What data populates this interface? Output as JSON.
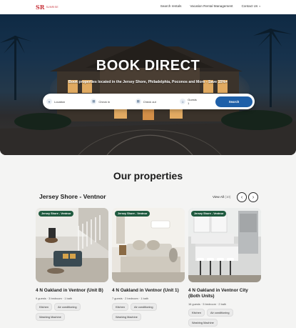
{
  "nav": {
    "logo_mark": "SR",
    "logo_text": "SUNRISE",
    "items": [
      {
        "label": "Search rentals",
        "has_caret": false
      },
      {
        "label": "Vacation Rental Management",
        "has_caret": false
      },
      {
        "label": "Contact Us",
        "has_caret": true
      }
    ]
  },
  "hero": {
    "title": "BOOK DIRECT",
    "subtitle": "Book properties located in the Jersey Shore, Philadelphia, Poconos and More - Save 15%+"
  },
  "search": {
    "location_label": "Location",
    "checkin_label": "Check in",
    "checkout_label": "Check out",
    "guests_label": "Guests",
    "guests_value": "1",
    "button_label": "Search"
  },
  "section": {
    "title": "Our properties",
    "group_title": "Jersey Shore - Ventnor",
    "view_all_label": "View All",
    "view_all_count": "(10)"
  },
  "cards": [
    {
      "badge": "Jersey Shore - Ventnor",
      "title": "4 N Oakland in Ventnor (Unit B)",
      "meta": "9 guests  ·  3 bedroom  ·  1 bath",
      "tags": [
        "Kitchen",
        "Air conditioning",
        "Washing Machine"
      ]
    },
    {
      "badge": "Jersey Shore - Ventnor",
      "title": "4 N Oakland in Ventnor (Unit 1)",
      "meta": "7 guests  ·  2 bedroom  ·  1 bath",
      "tags": [
        "Kitchen",
        "Air conditioning",
        "Washing Machine"
      ]
    },
    {
      "badge": "Jersey Shore - Ventnor",
      "title": "4 N Oakland in Ventnor City (Both Units)",
      "meta": "16 guests  ·  5 bedroom  ·  2 bath",
      "tags": [
        "Kitchen",
        "Air conditioning",
        "Washing Machine"
      ]
    }
  ],
  "colors": {
    "brand": "#c8323a",
    "search_button": "#1e5fa8",
    "badge": "#1f5a3f"
  }
}
